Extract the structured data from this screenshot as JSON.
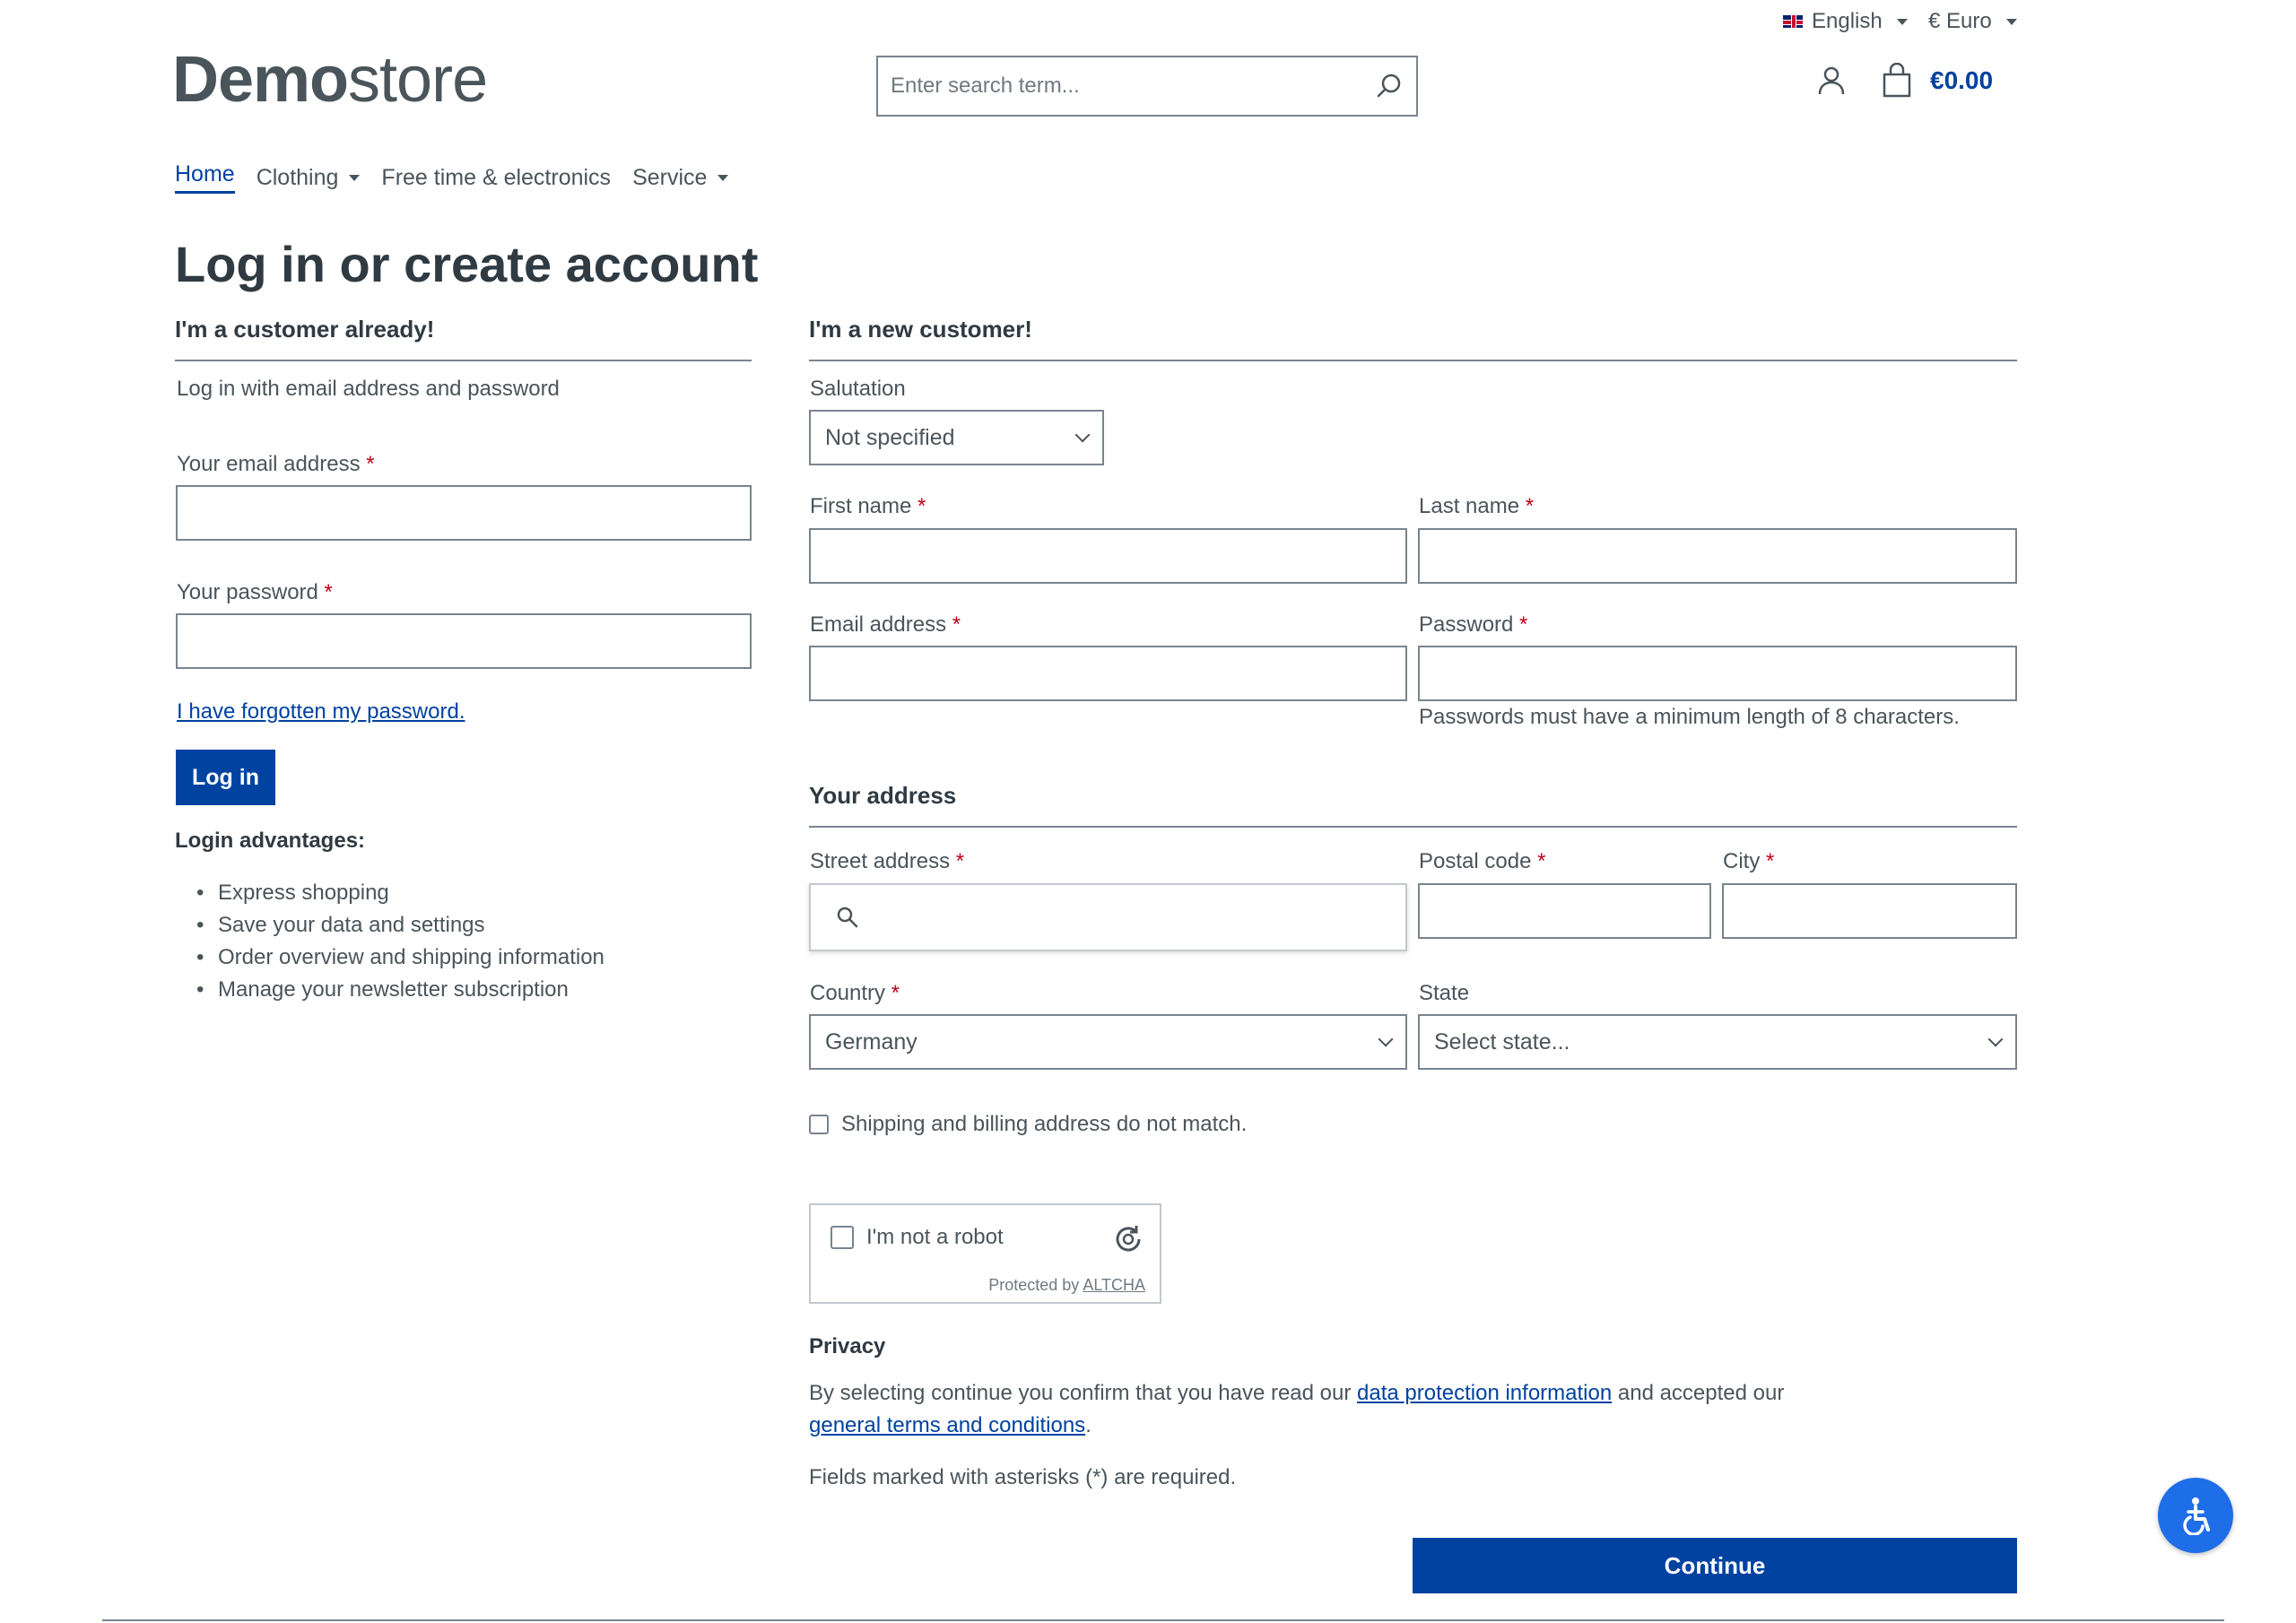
{
  "topbar": {
    "language": "English",
    "currency": "€ Euro"
  },
  "header": {
    "logo_bold": "Demo",
    "logo_light": "store",
    "search_placeholder": "Enter search term...",
    "cart_total": "€0.00"
  },
  "nav": {
    "items": [
      {
        "label": "Home",
        "active": true,
        "dropdown": false
      },
      {
        "label": "Clothing",
        "dropdown": true
      },
      {
        "label": "Free time & electronics",
        "dropdown": false
      },
      {
        "label": "Service",
        "dropdown": true
      }
    ]
  },
  "page_title": "Log in or create account",
  "login": {
    "heading": "I'm a customer already!",
    "intro": "Log in with email address and password",
    "email_label": "Your email address",
    "password_label": "Your password",
    "forgot_link": "I have forgotten my password.",
    "login_button": "Log in",
    "advantages_heading": "Login advantages:",
    "advantages": [
      "Express shopping",
      "Save your data and settings",
      "Order overview and shipping information",
      "Manage your newsletter subscription"
    ]
  },
  "register": {
    "heading": "I'm a new customer!",
    "salutation_label": "Salutation",
    "salutation_value": "Not specified",
    "first_name_label": "First name",
    "last_name_label": "Last name",
    "email_label": "Email address",
    "password_label": "Password",
    "password_hint": "Passwords must have a minimum length of 8 characters.",
    "address_heading": "Your address",
    "street_label": "Street address",
    "postal_label": "Postal code",
    "city_label": "City",
    "country_label": "Country",
    "country_value": "Germany",
    "state_label": "State",
    "state_value": "Select state...",
    "different_address_label": "Shipping and billing address do not match.",
    "captcha_label": "I'm not a robot",
    "captcha_protected": "Protected by",
    "captcha_brand": "ALTCHA",
    "privacy_heading": "Privacy",
    "privacy_text_1": "By selecting continue you confirm that you have read our",
    "privacy_link_1": "data protection information",
    "privacy_text_2": "and accepted our",
    "privacy_link_2": "general terms and conditions",
    "privacy_text_3": ".",
    "required_note": "Fields marked with asterisks (*) are required.",
    "continue_button": "Continue"
  },
  "required_marker": "*",
  "colors": {
    "primary": "#0042a0",
    "required": "#c2001a",
    "accessibility": "#1e6ee8"
  }
}
